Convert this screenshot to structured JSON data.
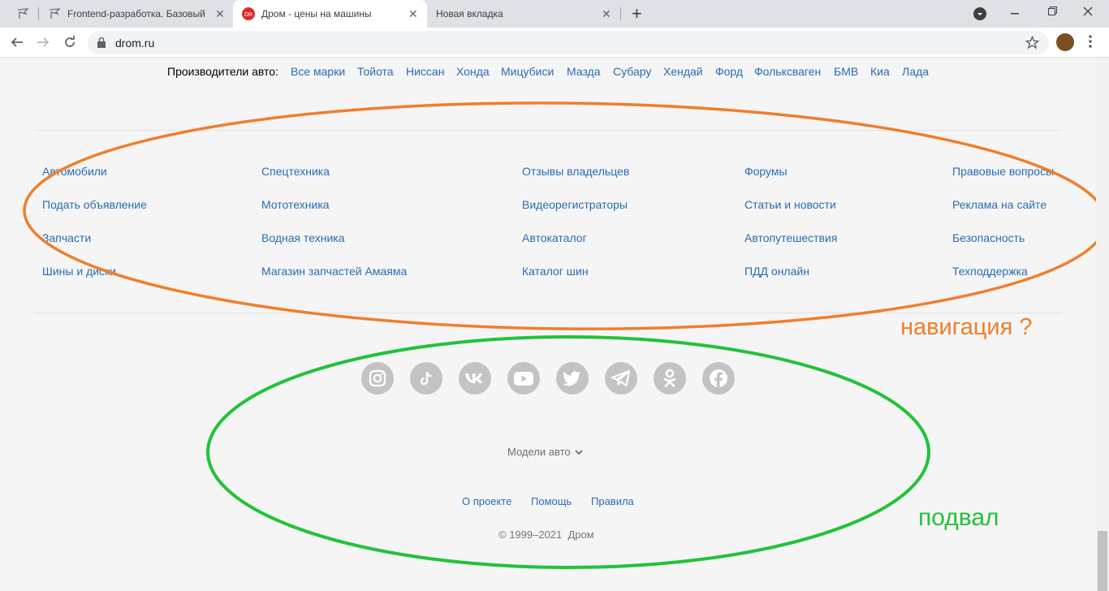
{
  "browser": {
    "tabs": [
      {
        "title": "",
        "close": ""
      },
      {
        "title": "Frontend-разработка. Базовый",
        "close": "✕"
      },
      {
        "title": "Дром - цены на машины",
        "close": "✕"
      },
      {
        "title": "Новая вкладка",
        "close": "✕"
      }
    ],
    "new_tab": "+",
    "url": "drom.ru",
    "accent": "#dee1e6"
  },
  "makers": {
    "label": "Производители авто:",
    "items": [
      "Все марки",
      "Тойота",
      "Ниссан",
      "Хонда",
      "Мицубиси",
      "Мазда",
      "Субару",
      "Хендай",
      "Форд",
      "Фольксваген",
      "БМВ",
      "Киа",
      "Лада"
    ]
  },
  "nav": {
    "columns": [
      [
        "Автомобили",
        "Подать объявление",
        "Запчасти",
        "Шины и диски"
      ],
      [
        "Спецтехника",
        "Мототехника",
        "Водная техника",
        "Магазин запчастей Амаяма"
      ],
      [
        "Отзывы владельцев",
        "Видеорегистраторы",
        "Автокаталог",
        "Каталог шин"
      ],
      [
        "Форумы",
        "Статьи и новости",
        "Автопутешествия",
        "ПДД онлайн"
      ],
      [
        "Правовые вопросы",
        "Реклама на сайте",
        "Безопасность",
        "Техподдержка"
      ]
    ]
  },
  "social": [
    "instagram-icon",
    "tiktok-icon",
    "vk-icon",
    "youtube-icon",
    "twitter-icon",
    "telegram-icon",
    "odnoklassniki-icon",
    "facebook-icon"
  ],
  "footer": {
    "models": "Модели авто",
    "links": [
      "О проекте",
      "Помощь",
      "Правила"
    ],
    "copyright": "© 1999–2021  Дром"
  },
  "annotations": {
    "navigation": "навигация ?",
    "footer": "подвал",
    "orange": "#f07e2a",
    "green": "#22c23a"
  }
}
